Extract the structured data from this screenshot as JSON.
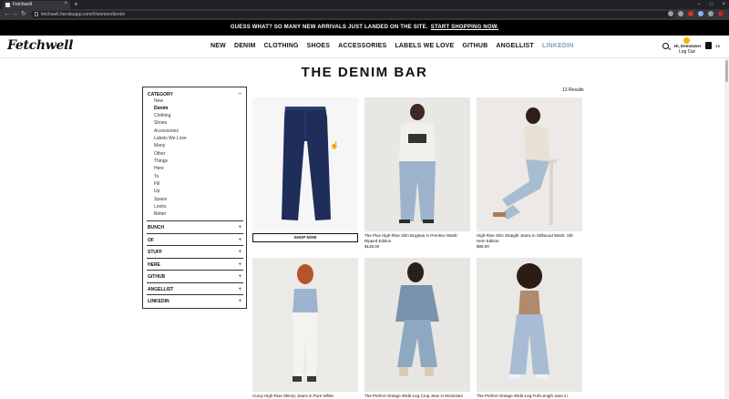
{
  "browser": {
    "tab_title": "Fetchwell",
    "url": "fetchwell.herokuapp.com/#/women/denim"
  },
  "promo": {
    "text": "GUESS WHAT? SO MANY NEW ARRIVALS JUST LANDED ON THE SITE.",
    "link": "START SHOPPING NOW."
  },
  "header": {
    "logo": "Fetchwell",
    "nav": [
      "NEW",
      "DENIM",
      "CLOTHING",
      "SHOES",
      "ACCESSORIES",
      "LABELS WE LOVE",
      "GITHUB",
      "ANGELLIST",
      "LINKEDIN"
    ],
    "greeting": "Hi, DemoUser",
    "logout": "Log Out",
    "bag_count": "15"
  },
  "page": {
    "title": "THE DENIM BAR",
    "results": "13 Results"
  },
  "filters": {
    "category_label": "CATEGORY",
    "category_toggle": "–",
    "categories": [
      "New",
      "Denim",
      "Clothing",
      "Shoes",
      "Accessories",
      "Labels We Love",
      "Many",
      "Other",
      "Things",
      "Here",
      "To",
      "Fill",
      "Up",
      "Space",
      "Looks",
      "Better"
    ],
    "active_category": "Denim",
    "groups": [
      "BUNCH",
      "OF",
      "STUFF",
      "HERE",
      "GITHUB",
      "ANGELLIST",
      "LINKEDIN"
    ],
    "group_toggle": "+"
  },
  "products": [
    {
      "name": "",
      "price": "",
      "button": "SHOP NOW"
    },
    {
      "name": "The Plus High-Rise Slim Boyjean in Prentice Wash: Ripped Edition",
      "price": "$138.00"
    },
    {
      "name": "High-Rise Slim Straight Jeans in Stillwood Wash: Slit-Hem Edition",
      "price": "$98.00"
    },
    {
      "name": "Curvy High-Rise Skinny Jeans in Pure White",
      "price": ""
    },
    {
      "name": "The Perfect Vintage Wide-Leg Crop Jean in Montclare",
      "price": ""
    },
    {
      "name": "The Perfect Vintage Wide-Leg Full-Length Jean in",
      "price": ""
    }
  ],
  "colors": {
    "promo_bg": "#000000",
    "denim_dark": "#1f2d5a",
    "denim_light": "#9db3cc",
    "muted_nav": "#8aa0b5"
  }
}
